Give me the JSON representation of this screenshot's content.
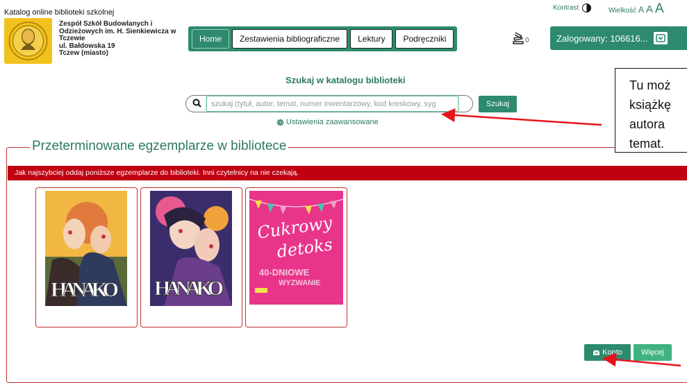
{
  "header": {
    "catalog_title": "Katalog online biblioteki szkolnej",
    "school": [
      "Zespół Szkół Budowlanych i",
      "Odzieżowych im. H. Sienkiewicza w",
      "Tczewie",
      "ul. Bałdowska 19",
      "Tczew (miasto)"
    ],
    "contrast_label": "Kontrast",
    "size_label": "Wielkość",
    "size_options": [
      "A",
      "A",
      "A"
    ],
    "cart_count": "0",
    "user_label": "Zalogowany: 106616..."
  },
  "nav": {
    "items": [
      {
        "label": "Home"
      },
      {
        "label": "Zestawienia bibliograficzne"
      },
      {
        "label": "Lektury"
      },
      {
        "label": "Podręczniki"
      }
    ]
  },
  "search": {
    "heading": "Szukaj w katalogu biblioteki",
    "placeholder": "szukaj (tytuł, autor, temat, numer inwentarzowy, kod kreskowy, syg",
    "button_label": "Szukaj",
    "advanced_label": "Ustawienia zaawansowane"
  },
  "overdue": {
    "legend": "Przeterminowane egzemplarze w bibliotece",
    "alert": "Jak najszybciej oddaj poniższe egzemplarze do biblioteki. Inni czytelnicy na nie czekają.",
    "books": [
      {
        "cover_text": "HANAKO"
      },
      {
        "cover_text": "HANAKO"
      },
      {
        "cover_script": "Cukrowy",
        "cover_script2": "detoks",
        "cover_sub": "40-DNIOWE",
        "cover_sub2": "WYZWANIE"
      }
    ]
  },
  "actions": {
    "konto_label": "Konto",
    "wiecej_label": "Więcej"
  },
  "callout": {
    "lines": [
      "Tu moż",
      "książkę",
      "autora",
      "temat."
    ]
  },
  "colors": {
    "accent": "#2d8a6f",
    "alert": "#c00010",
    "frame": "#c0312b",
    "annotation": "#e8141b"
  }
}
